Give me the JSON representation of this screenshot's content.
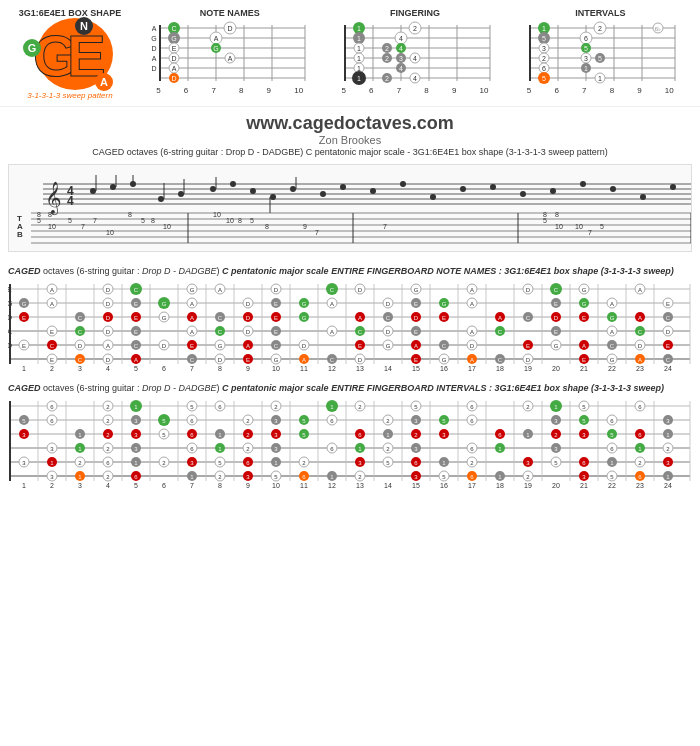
{
  "header": {
    "logo_label": "3G1:6E4E1\nBOX SHAPE",
    "logo_letters": "GE",
    "sweep_label": "3-1-3-1-3 sweep pattern",
    "diagrams": [
      {
        "title": "NOTE NAMES",
        "fret_start": 5,
        "fret_end": 10
      },
      {
        "title": "FINGERING",
        "fret_start": 5,
        "fret_end": 10
      },
      {
        "title": "INTERVALS",
        "fret_start": 5,
        "fret_end": 10
      }
    ]
  },
  "website": {
    "url": "www.cagedoctaves.com",
    "author": "Zon Brookes",
    "description": "CAGED octaves (6-string guitar : Drop D - DADGBE) C pentatonic major scale - 3G1:6E4E1 box shape (3-1-3-1-3 sweep pattern)"
  },
  "fingerboard_notes": {
    "title": "CAGED octaves (6-string guitar : Drop D - DADGBE) C pentatonic major scale ENTIRE FINGERBOARD NOTE NAMES : 3G1:6E4E1 box shape (3-1-3-1-3 sweep)",
    "fret_numbers": [
      "1",
      "2",
      "3",
      "4",
      "5",
      "6",
      "7",
      "8",
      "9",
      "10",
      "11",
      "12",
      "13",
      "14",
      "15",
      "16",
      "17",
      "18",
      "19",
      "20",
      "21",
      "22",
      "23",
      "24"
    ]
  },
  "fingerboard_intervals": {
    "title": "CAGED octaves (6-string guitar : Drop D - DADGBE) C pentatonic major scale ENTIRE FINGERBOARD INTERVALS : 3G1:6E4E1 box shape (3-1-3-1-3 sweep)",
    "fret_numbers": [
      "1",
      "2",
      "3",
      "4",
      "5",
      "6",
      "7",
      "8",
      "9",
      "10",
      "11",
      "12",
      "13",
      "14",
      "15",
      "16",
      "17",
      "18",
      "19",
      "20",
      "21",
      "22",
      "23",
      "24"
    ]
  },
  "caged_label": "CAGED",
  "colors": {
    "orange": "#FF6600",
    "green": "#44AA44",
    "red": "#CC0000",
    "gray": "#888888",
    "dark": "#333333",
    "white": "#FFFFFF"
  }
}
